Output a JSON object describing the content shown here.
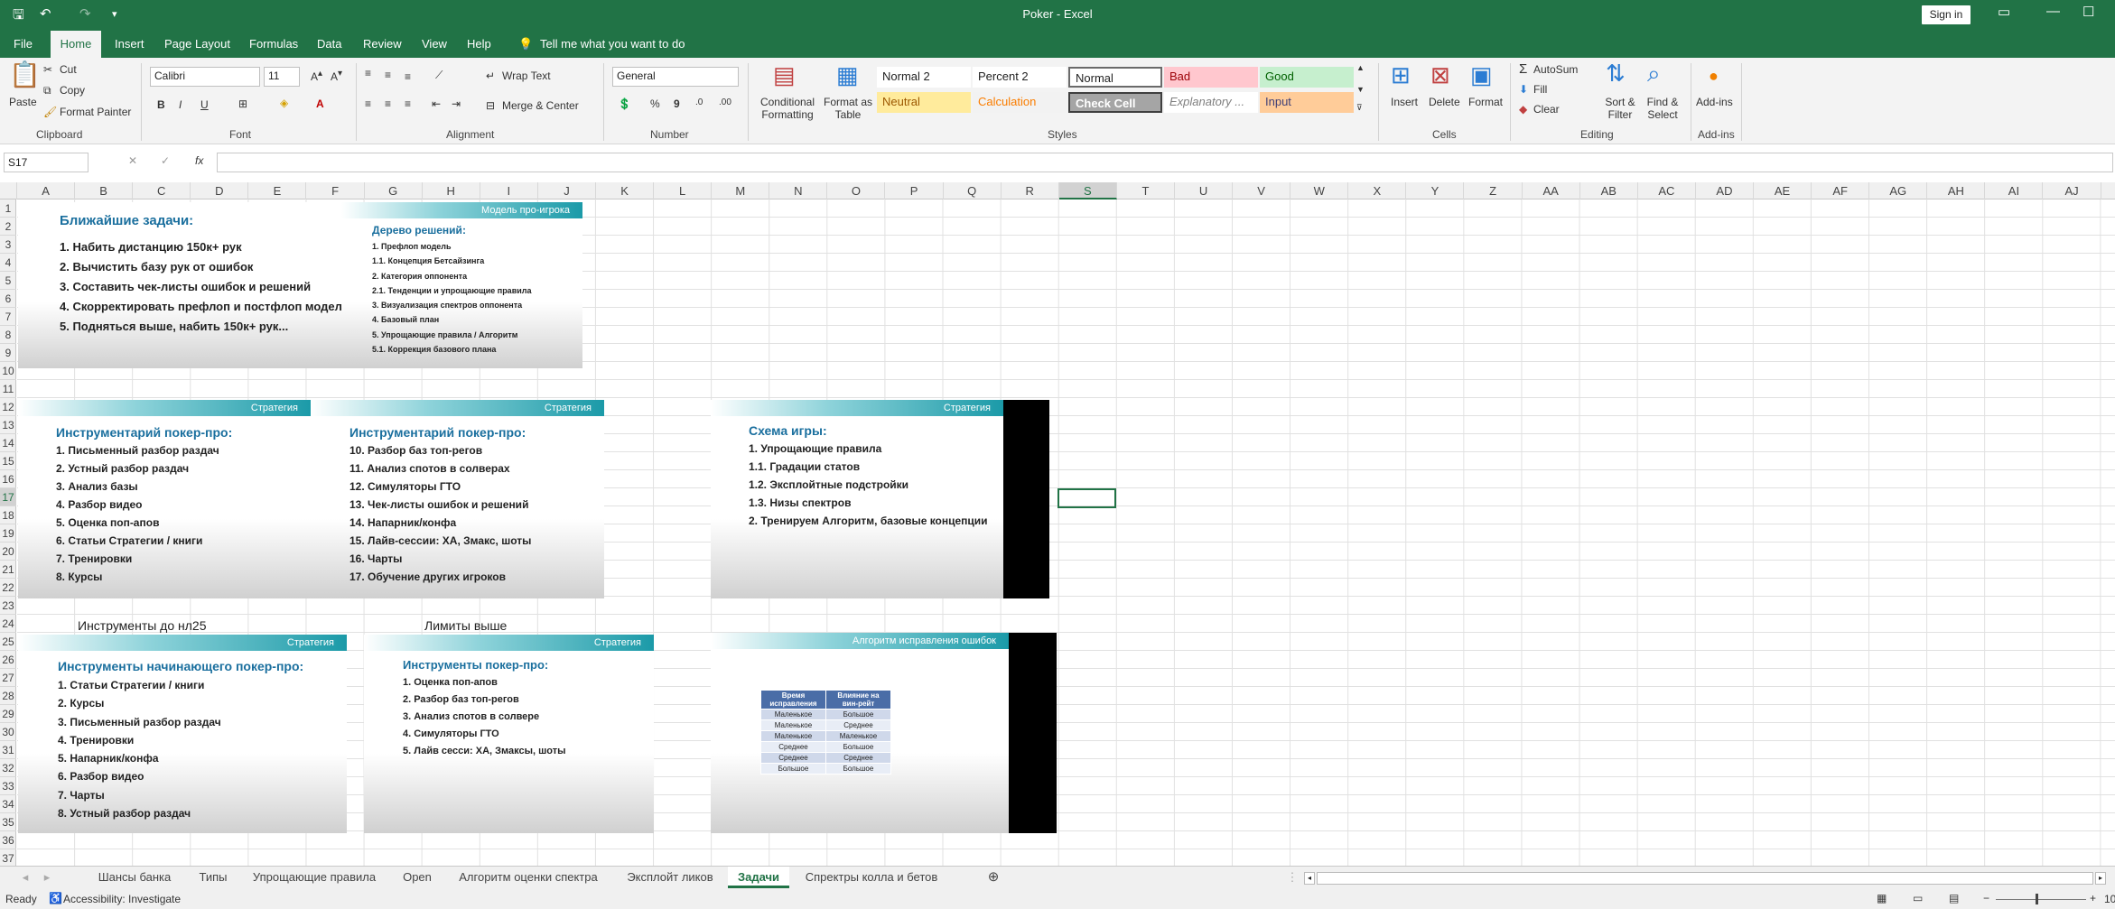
{
  "window": {
    "title": "Poker  -  Excel",
    "sign_in": "Sign in"
  },
  "menu": {
    "items": [
      "File",
      "Home",
      "Insert",
      "Page Layout",
      "Formulas",
      "Data",
      "Review",
      "View",
      "Help"
    ],
    "tell_me": "Tell me what you want to do",
    "active": "Home"
  },
  "ribbon": {
    "clipboard": {
      "paste": "Paste",
      "cut": "Cut",
      "copy": "Copy",
      "format_painter": "Format Painter",
      "label": "Clipboard"
    },
    "font": {
      "name": "Calibri",
      "size": "11",
      "label": "Font"
    },
    "alignment": {
      "wrap_text": "Wrap Text",
      "merge_center": "Merge & Center",
      "label": "Alignment"
    },
    "number": {
      "format": "General",
      "label": "Number"
    },
    "styles": {
      "conditional": "Conditional Formatting",
      "format_table": "Format as Table",
      "label": "Styles",
      "cells": [
        {
          "name": "Normal 2",
          "bg": "#ffffff",
          "fg": "#222222"
        },
        {
          "name": "Percent 2",
          "bg": "#ffffff",
          "fg": "#222222"
        },
        {
          "name": "Normal",
          "bg": "#ffffff",
          "fg": "#222222"
        },
        {
          "name": "Bad",
          "bg": "#ffc7ce",
          "fg": "#9c0006"
        },
        {
          "name": "Good",
          "bg": "#c6efce",
          "fg": "#006100"
        },
        {
          "name": "Neutral",
          "bg": "#ffeb9c",
          "fg": "#9c5700"
        },
        {
          "name": "Calculation",
          "bg": "#f2f2f2",
          "fg": "#fa7d00"
        },
        {
          "name": "Check Cell",
          "bg": "#a5a5a5",
          "fg": "#ffffff"
        },
        {
          "name": "Explanatory ...",
          "bg": "#ffffff",
          "fg": "#7f7f7f"
        },
        {
          "name": "Input",
          "bg": "#ffcc99",
          "fg": "#3f3f76"
        }
      ]
    },
    "cells_group": {
      "insert": "Insert",
      "delete": "Delete",
      "format": "Format",
      "label": "Cells"
    },
    "editing": {
      "autosum": "AutoSum",
      "fill": "Fill",
      "clear": "Clear",
      "sort_filter": "Sort & Filter",
      "find_select": "Find & Select",
      "label": "Editing"
    },
    "addins": {
      "button": "Add-ins",
      "label": "Add-ins"
    }
  },
  "formula_bar": {
    "name_box": "S17",
    "fx": "fx",
    "content": ""
  },
  "columns": [
    "A",
    "B",
    "C",
    "D",
    "E",
    "F",
    "G",
    "H",
    "I",
    "J",
    "K",
    "L",
    "M",
    "N",
    "O",
    "P",
    "Q",
    "R",
    "S",
    "T",
    "U",
    "V",
    "W",
    "X",
    "Y",
    "Z",
    "AA",
    "AB",
    "AC",
    "AD",
    "AE",
    "AF",
    "AG",
    "AH",
    "AI",
    "AJ"
  ],
  "rows": [
    "1",
    "2",
    "3",
    "4",
    "5",
    "6",
    "7",
    "8",
    "9",
    "10",
    "11",
    "12",
    "13",
    "14",
    "15",
    "16",
    "17",
    "18",
    "19",
    "20",
    "21",
    "22",
    "23",
    "24",
    "25",
    "26",
    "27",
    "28",
    "29",
    "30",
    "31",
    "32",
    "33",
    "34",
    "35",
    "36",
    "37"
  ],
  "cells": {
    "b24": "Инструменты до нл25",
    "g24": "Лимиты выше"
  },
  "slides": {
    "s1": {
      "title": "Ближайшие задачи:",
      "items": [
        "1.   Набить дистанцию 150к+ рук",
        "2.   Вычистить базу рук от ошибок",
        "3.   Составить чек-листы ошибок и решений",
        "4.   Скорректировать префлоп и постфлоп модели",
        "5.   Подняться выше, набить 150к+ рук..."
      ]
    },
    "s2": {
      "band": "Модель про-игрока",
      "title": "Дерево решений:",
      "items": [
        "1. Префлоп модель",
        "1.1. Концепция Бетсайзинга",
        "2. Категория оппонента",
        "2.1. Тенденции и упрощающие правила",
        "3. Визуализация спектров оппонента",
        "4. Базовый план",
        "5. Упрощающие правила / Алгоритм",
        "5.1. Коррекция базового плана"
      ]
    },
    "s3": {
      "band": "Стратегия",
      "title": "Инструментарий покер-про:",
      "items": [
        "1. Письменный разбор раздач",
        "2. Устный разбор раздач",
        "3. Анализ базы",
        "4. Разбор видео",
        "5. Оценка поп-апов",
        "6. Статьи Стратегии / книги",
        "7. Тренировки",
        "8. Курсы"
      ]
    },
    "s4": {
      "band": "Стратегия",
      "title": "Инструментарий покер-про:",
      "items": [
        "10. Разбор баз топ-регов",
        "11. Анализ спотов в солверах",
        "12. Симуляторы ГТО",
        "13. Чек-листы ошибок и решений",
        "14. Напарник/конфа",
        "15. Лайв-сессии: ХА, Змакс, шоты",
        "16. Чарты",
        "17. Обучение других игроков"
      ]
    },
    "s5": {
      "band": "Стратегия",
      "title": "Схема игры:",
      "items": [
        "1.    Упрощающие правила",
        "1.1. Градации статов",
        "1.2. Эксплойтные подстройки",
        "1.3. Низы спектров",
        "2. Тренируем Алгоритм, базовые концепции"
      ]
    },
    "s6": {
      "band": "Стратегия",
      "title": "Инструменты начинающего покер-про:",
      "items": [
        "1. Статьи Стратегии / книги",
        "2. Курсы",
        "3. Письменный разбор раздач",
        "4. Тренировки",
        "5. Напарник/конфа",
        "6. Разбор видео",
        "7. Чарты",
        "8. Устный разбор раздач"
      ]
    },
    "s7": {
      "band": "Стратегия",
      "title": "Инструменты покер-про:",
      "items": [
        "1. Оценка поп-апов",
        "2. Разбор баз топ-регов",
        "3. Анализ спотов в солвере",
        "4. Симуляторы ГТО",
        "5. Лайв сесси: ХА, Змаксы, шоты"
      ]
    },
    "s8": {
      "band": "Алгоритм исправления ошибок",
      "table": {
        "headers": [
          "Время исправления",
          "Влияние на вин-рейт"
        ],
        "rows": [
          [
            "Маленькое",
            "Большое"
          ],
          [
            "Маленькое",
            "Среднее"
          ],
          [
            "Маленькое",
            "Маленькое"
          ],
          [
            "Среднее",
            "Большое"
          ],
          [
            "Среднее",
            "Среднее"
          ],
          [
            "Большое",
            "Большое"
          ]
        ]
      }
    }
  },
  "sheet_tabs": {
    "tabs": [
      "Шансы банка",
      "Типы",
      "Упрощающие правила",
      "Open",
      "Алгоритм оценки спектра",
      "Эксплойт ликов",
      "Задачи",
      "Спректры колла и бетов"
    ],
    "active": "Задачи"
  },
  "status": {
    "ready": "Ready",
    "accessibility": "Accessibility: Investigate",
    "zoom": "10"
  }
}
